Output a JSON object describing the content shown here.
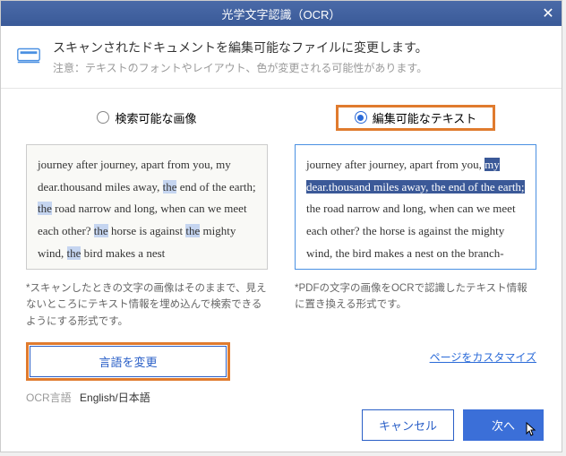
{
  "titlebar": {
    "title": "光学文字認識（OCR）"
  },
  "header": {
    "title": "スキャンされたドキュメントを編集可能なファイルに変更します。",
    "note": "注意：テキストのフォントやレイアウト、色が変更される可能性があります。"
  },
  "left": {
    "radio_label": "検索可能な画像",
    "preview_parts": {
      "p1": "journey after journey, apart from you, my dear.thousand miles away, ",
      "p2": "the",
      "p3": " end of the earth; ",
      "p4": "the",
      "p5": " road narrow and long, when can we meet each other? ",
      "p6": "the",
      "p7": " horse is against ",
      "p8": "the",
      "p9": " mighty wind, ",
      "p10": "the",
      "p11": " bird makes a nest"
    },
    "desc": "*スキャンしたときの文字の画像はそのままで、見えないところにテキスト情報を埋め込んで検索できるようにする形式です。",
    "lang_button": "言語を変更",
    "ocr_label": "OCR言語",
    "ocr_value": "English/日本語"
  },
  "right": {
    "radio_label": "編集可能なテキスト",
    "preview_parts": {
      "p1": "journey after journey, apart from you, ",
      "p2": "my dear.thousand miles away, the end of the earth;",
      "p3": " the road narrow and long, when can we meet each other? the horse is against the mighty wind, the bird makes a nest on the branch-"
    },
    "desc": "*PDFの文字の画像をOCRで認識したテキスト情報に置き換える形式です。",
    "customize_link": "ページをカスタマイズ"
  },
  "footer": {
    "cancel": "キャンセル",
    "next": "次へ"
  }
}
